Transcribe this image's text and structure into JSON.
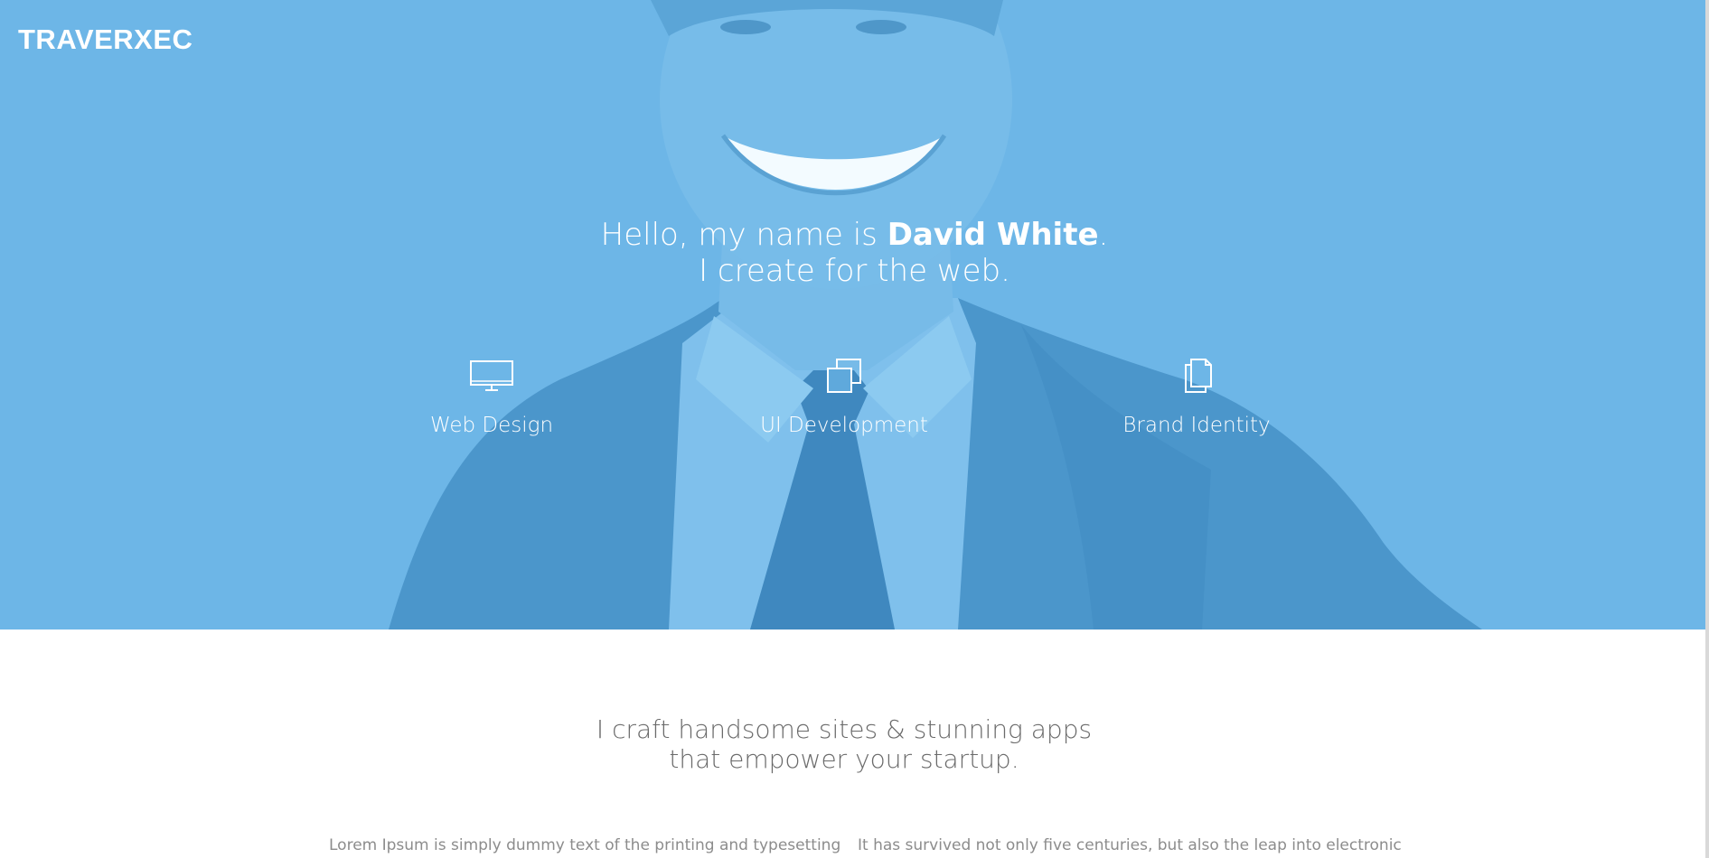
{
  "brand": {
    "logo_text": "TRAVERXEC"
  },
  "hero": {
    "greeting_prefix": "Hello, my name is ",
    "name": "David White",
    "greeting_suffix": ".",
    "subline": "I create for the web.",
    "services": [
      {
        "label": "Web Design",
        "icon": "monitor-icon"
      },
      {
        "label": "UI Development",
        "icon": "copy-windows-icon"
      },
      {
        "label": "Brand Identity",
        "icon": "documents-icon"
      }
    ]
  },
  "about": {
    "tagline_line1": "I craft handsome sites & stunning apps",
    "tagline_line2": "that empower your startup.",
    "col_left": "Lorem Ipsum is simply dummy text of the printing and typesetting",
    "col_right": "It has survived not only five centuries, but also the leap into electronic"
  },
  "colors": {
    "hero_overlay": "#6eb6e6",
    "hero_dark": "#4a96c9",
    "text_white": "#ffffff",
    "tagline": "#6a6a6a",
    "body_text": "#8c8c8c"
  }
}
